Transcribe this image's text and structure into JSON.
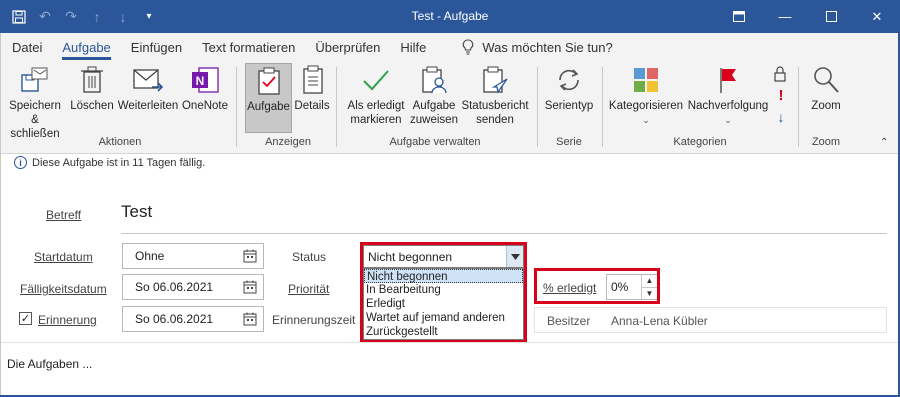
{
  "window": {
    "title": "Test  -  Aufgabe",
    "accent": "#2b579a"
  },
  "tabs": [
    {
      "label": "Datei"
    },
    {
      "label": "Aufgabe"
    },
    {
      "label": "Einfügen"
    },
    {
      "label": "Text formatieren"
    },
    {
      "label": "Überprüfen"
    },
    {
      "label": "Hilfe"
    }
  ],
  "tell_me": "Was möchten Sie tun?",
  "ribbon": {
    "save_close": [
      "Speichern",
      "& schließen"
    ],
    "delete": "Löschen",
    "forward": "Weiterleiten",
    "onenote": "OneNote",
    "task": "Aufgabe",
    "details": "Details",
    "mark_complete": [
      "Als erledigt",
      "markieren"
    ],
    "assign": [
      "Aufgabe",
      "zuweisen"
    ],
    "status_report": [
      "Statusbericht",
      "senden"
    ],
    "recurrence": "Serientyp",
    "categorize": "Kategorisieren",
    "follow_up": "Nachverfolgung",
    "zoom": "Zoom",
    "groups": {
      "actions": "Aktionen",
      "show": "Anzeigen",
      "manage": "Aufgabe verwalten",
      "recurrence": "Serie",
      "tags": "Kategorien",
      "zoom": "Zoom"
    }
  },
  "info_bar": "Diese Aufgabe ist in 11 Tagen fällig.",
  "form": {
    "subject_label": "Betreff",
    "subject_value": "Test",
    "start_label": "Startdatum",
    "start_value": "Ohne",
    "due_label": "Fälligkeitsdatum",
    "due_value": "So 06.06.2021",
    "reminder_label": "Erinnerung",
    "reminder_checked": true,
    "reminder_value": "So 06.06.2021",
    "reminder_time_label": "Erinnerungszeit",
    "status_label": "Status",
    "status_value": "Nicht begonnen",
    "status_options": [
      "Nicht begonnen",
      "In Bearbeitung",
      "Erledigt",
      "Wartet auf jemand anderen",
      "Zurückgestellt"
    ],
    "priority_label": "Priorität",
    "percent_label": "% erledigt",
    "percent_value": "0%",
    "owner_label": "Besitzer",
    "owner_value": "Anna-Lena Kübler"
  },
  "body_text": "Die Aufgaben ...",
  "highlight_color": "#d9001b"
}
